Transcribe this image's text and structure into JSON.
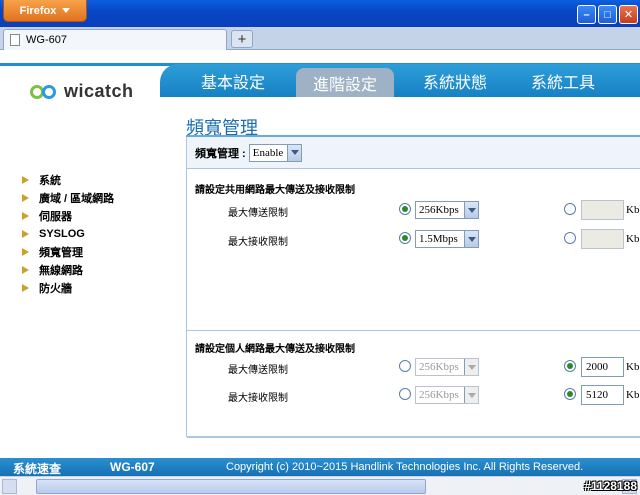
{
  "browser": {
    "app_button": "Firefox",
    "tab_title": "WG-607",
    "new_tab": "+"
  },
  "brand": {
    "logo_text": "wicatch"
  },
  "nav": {
    "tabs": [
      "基本設定",
      "進階設定",
      "系統狀態",
      "系統工具"
    ],
    "active": "進階設定"
  },
  "page": {
    "title": "頻寬管理"
  },
  "sidebar": {
    "items": [
      "系統",
      "廣域 / 區域網路",
      "伺服器",
      "SYSLOG",
      "頻寬管理",
      "無線網路",
      "防火牆"
    ]
  },
  "bandwidth": {
    "label": "頻寬管理 :",
    "value": "Enable",
    "shared": {
      "title": "請設定共用網路最大傳送及接收限制",
      "upload": {
        "label": "最大傳送限制",
        "preset": "256Kbps",
        "custom": "",
        "unit": "Kb",
        "mode": "preset"
      },
      "download": {
        "label": "最大接收限制",
        "preset": "1.5Mbps",
        "custom": "",
        "unit": "Kb",
        "mode": "preset"
      }
    },
    "personal": {
      "title": "請設定個人網路最大傳送及接收限制",
      "upload": {
        "label": "最大傳送限制",
        "preset": "256Kbps",
        "custom": "2000",
        "unit": "Kb",
        "mode": "custom"
      },
      "download": {
        "label": "最大接收限制",
        "preset": "256Kbps",
        "custom": "5120",
        "unit": "Kb",
        "mode": "custom"
      }
    }
  },
  "footer": {
    "product_label": "系統速查",
    "model": "WG-607",
    "copyright": "Copyright (c) 2010~2015 Handlink Technologies Inc. All Rights Reserved."
  },
  "watermark": "#1128188"
}
